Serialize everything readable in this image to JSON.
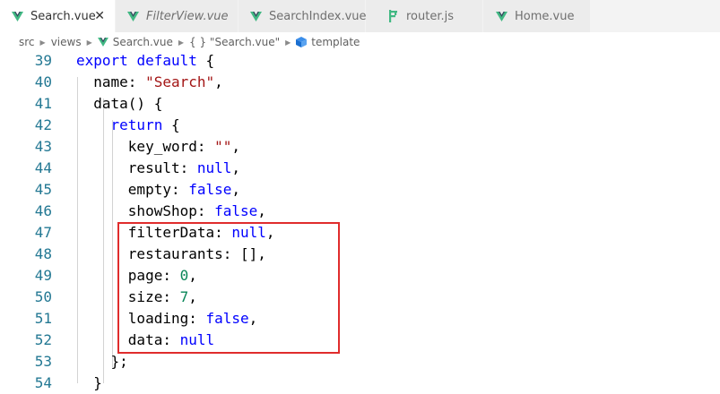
{
  "tabs": [
    {
      "label": "Search.vue",
      "icon": "vue-icon",
      "active": true,
      "italic": false
    },
    {
      "label": "FilterView.vue",
      "icon": "vue-icon",
      "active": false,
      "italic": true
    },
    {
      "label": "SearchIndex.vue",
      "icon": "vue-icon",
      "active": false,
      "italic": false
    },
    {
      "label": "router.js",
      "icon": "js-icon",
      "active": false,
      "italic": false
    },
    {
      "label": "Home.vue",
      "icon": "vue-icon",
      "active": false,
      "italic": false
    }
  ],
  "close_glyph": "✕",
  "breadcrumb": {
    "items": [
      "src",
      "views",
      "Search.vue",
      "{ } \"Search.vue\"",
      "template"
    ]
  },
  "code": [
    {
      "n": "39",
      "text": "export default {"
    },
    {
      "n": "40",
      "text": "  name: \"Search\","
    },
    {
      "n": "41",
      "text": "  data() {"
    },
    {
      "n": "42",
      "text": "    return {"
    },
    {
      "n": "43",
      "text": "      key_word: \"\","
    },
    {
      "n": "44",
      "text": "      result: null,"
    },
    {
      "n": "45",
      "text": "      empty: false,"
    },
    {
      "n": "46",
      "text": "      showShop: false,"
    },
    {
      "n": "47",
      "text": "      filterData: null,"
    },
    {
      "n": "48",
      "text": "      restaurants: [],"
    },
    {
      "n": "49",
      "text": "      page: 0,"
    },
    {
      "n": "50",
      "text": "      size: 7,"
    },
    {
      "n": "51",
      "text": "      loading: false,"
    },
    {
      "n": "52",
      "text": "      data: null"
    },
    {
      "n": "53",
      "text": "    };"
    },
    {
      "n": "54",
      "text": "  }"
    }
  ],
  "colors": {
    "keyword": "#0000ff",
    "string": "#a31515",
    "number": "#098658",
    "line_number": "#237893",
    "highlight_border": "#e02c2c",
    "vue_green": "#41b883",
    "vue_dark": "#35495e"
  }
}
